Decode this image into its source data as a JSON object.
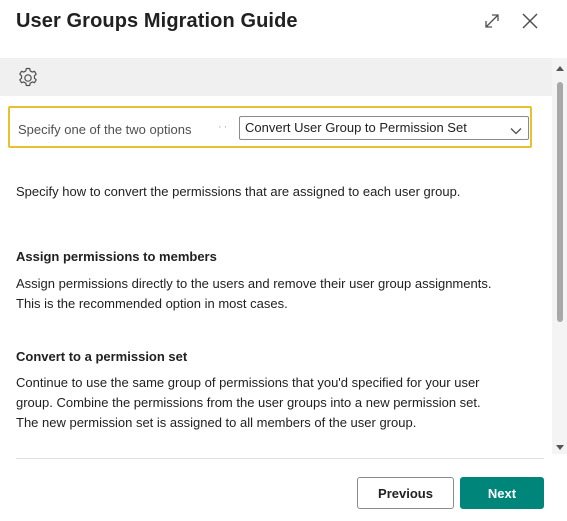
{
  "dialog": {
    "title": "User Groups Migration Guide",
    "icons": {
      "expand": "expand-icon",
      "close": "close-icon",
      "settings": "gear-icon"
    }
  },
  "option": {
    "label": "Specify one of the two options",
    "selected": "Convert User Group to Permission Set"
  },
  "content": {
    "description": "Specify how to convert the permissions that are assigned to each user group.",
    "section1": {
      "heading": "Assign permissions to members",
      "line1": "Assign permissions directly to the users and remove their user group assignments.",
      "line2": "This is the recommended option in most cases."
    },
    "section2": {
      "heading": "Convert to a permission set",
      "line1": "Continue to use the same group of permissions that you'd specified for your user",
      "line2": "group. Combine the permissions from the user groups into a new permission set.",
      "line3": "The new permission set is assigned to all members of the user group."
    }
  },
  "footer": {
    "previous_label": "Previous",
    "next_label": "Next"
  },
  "colors": {
    "accent": "#00857a",
    "focus_border": "#e8c030",
    "toolbar_bg": "#f0f0f0"
  }
}
